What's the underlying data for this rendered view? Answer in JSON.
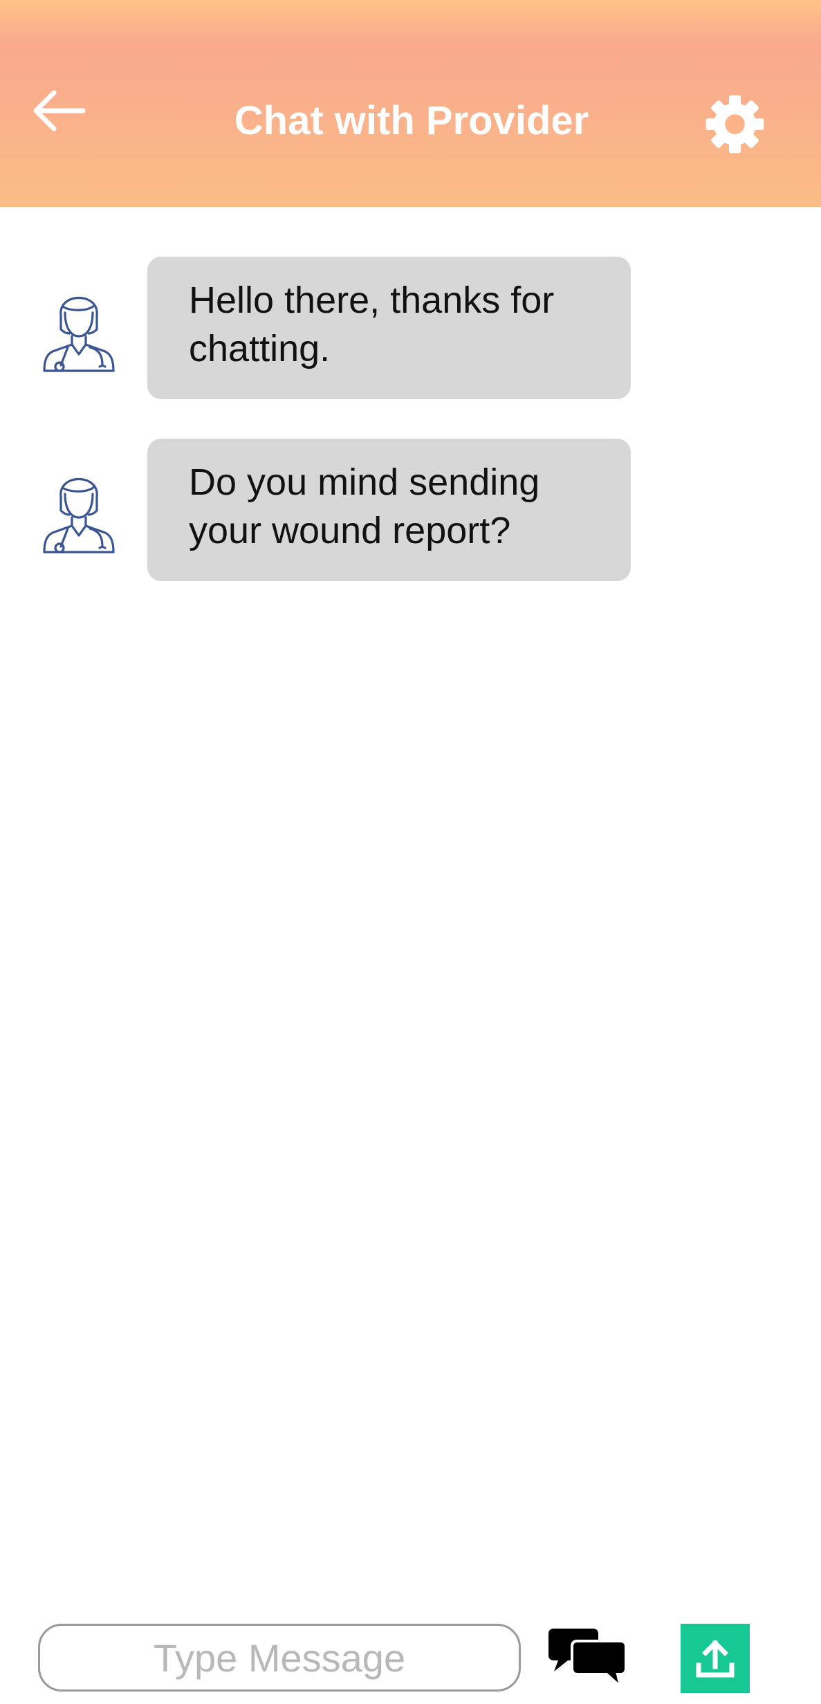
{
  "header": {
    "title": "Chat with Provider",
    "back_icon": "arrow-left-icon",
    "settings_icon": "gear-icon",
    "gradient_colors": [
      "#ffc389",
      "#f9a98f",
      "#fbbd86"
    ]
  },
  "messages": [
    {
      "sender": "provider",
      "avatar_icon": "doctor-avatar-icon",
      "text": "Hello there, thanks for chatting."
    },
    {
      "sender": "provider",
      "avatar_icon": "doctor-avatar-icon",
      "text": "Do you mind sending your wound report?"
    }
  ],
  "composer": {
    "value": "",
    "placeholder": "Type Message",
    "chat_icon": "chat-bubbles-icon",
    "upload_icon": "upload-icon",
    "upload_color": "#18c894"
  },
  "colors": {
    "bubble": "#d7d7d7",
    "avatar_stroke": "#3a5592"
  }
}
